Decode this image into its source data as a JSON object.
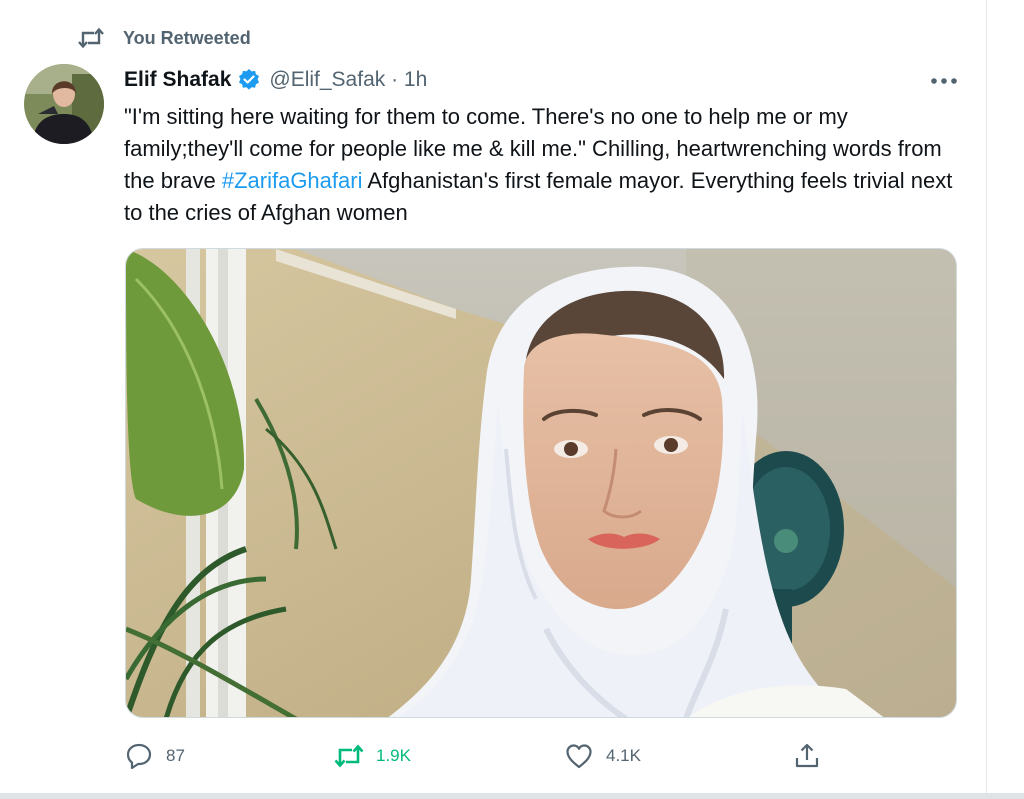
{
  "retweet_banner": {
    "label": "You Retweeted"
  },
  "tweet": {
    "author_name": "Elif Shafak",
    "handle_time": "@Elif_Safak · 1h",
    "text_before_hashtag": "\"I'm sitting here waiting for them to come. There's no one to help me or my family;they'll come for people like me & kill me.\" Chilling, heartwrenching words from the brave ",
    "hashtag": "#ZarifaGhafari",
    "text_after_hashtag": " Afghanistan's first female mayor. Everything feels trivial next to the cries of Afghan women"
  },
  "actions": {
    "reply_count": "87",
    "retweet_count": "1.9K",
    "like_count": "4.1K"
  },
  "icons": {
    "retweet_banner": "retweet-icon",
    "verified": "verified-badge-icon",
    "more": "more-horizontal-icon",
    "reply": "reply-icon",
    "retweet": "retweet-icon",
    "like": "heart-icon",
    "share": "share-icon"
  },
  "colors": {
    "text": "#0f1419",
    "secondary": "#536471",
    "link": "#1d9bf0",
    "retweet_active": "#00ba7c"
  }
}
